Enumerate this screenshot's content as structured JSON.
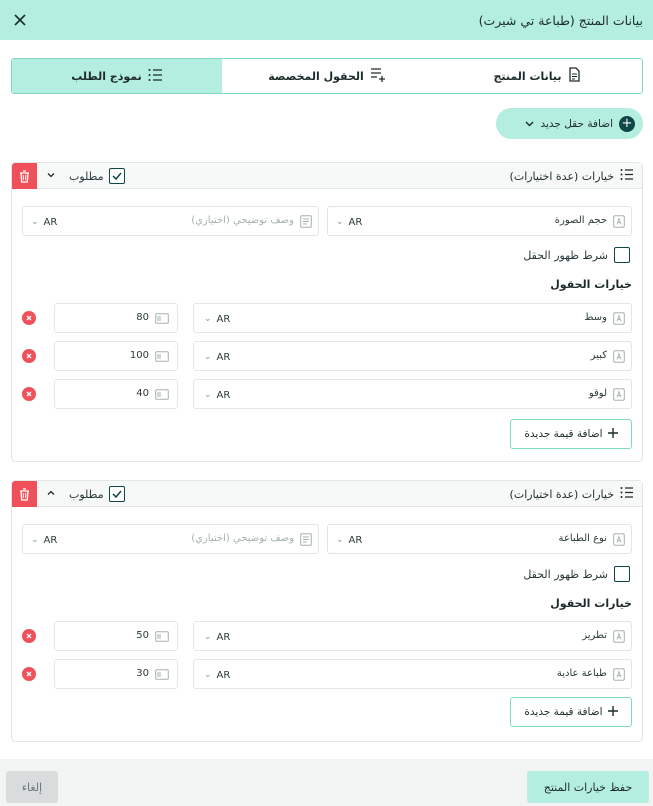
{
  "header": {
    "title": "بيانات المنتج (طباعة تي شيرت)"
  },
  "tabs": [
    {
      "label": "بيانات المنتج",
      "icon": "document-icon",
      "active": false
    },
    {
      "label": "الحقول المخصصة",
      "icon": "list-add-icon",
      "active": false
    },
    {
      "label": "نموذج الطلب",
      "icon": "list-icon",
      "active": true
    }
  ],
  "add_field": {
    "label": "اضافة حقل جديد"
  },
  "cards": [
    {
      "title": "خيارات (عدة اختيارات)",
      "required_label": "مطلوب",
      "required_checked": true,
      "name_value": "حجم الصورة",
      "name_lang": "AR",
      "desc_placeholder": "وصف توضيحي (اختياري)",
      "desc_lang": "AR",
      "condition_label": "شرط ظهور الحقل",
      "options_title": "خيارات الحقول",
      "options": [
        {
          "label": "وسط",
          "lang": "AR",
          "price": "80"
        },
        {
          "label": "كبير",
          "lang": "AR",
          "price": "100"
        },
        {
          "label": "لوقو",
          "lang": "AR",
          "price": "40"
        }
      ],
      "add_value_label": "اضافة قيمة جديدة"
    },
    {
      "title": "خيارات (عدة اختيارات)",
      "required_label": "مطلوب",
      "required_checked": true,
      "name_value": "نوع الطباعة",
      "name_lang": "AR",
      "desc_placeholder": "وصف توضيحي (اختياري)",
      "desc_lang": "AR",
      "condition_label": "شرط ظهور الحقل",
      "options_title": "خيارات الحقول",
      "options": [
        {
          "label": "تطريز",
          "lang": "AR",
          "price": "50"
        },
        {
          "label": "طباعة عادية",
          "lang": "AR",
          "price": "30"
        }
      ],
      "add_value_label": "اضافة قيمة جديدة"
    }
  ],
  "footer": {
    "save_label": "حفظ خيارات المنتج",
    "cancel_label": "إلغاء"
  },
  "colors": {
    "accent": "#b4eee0",
    "accent_border": "#7fdac3",
    "danger": "#f0505a",
    "dark": "#0f4747"
  }
}
